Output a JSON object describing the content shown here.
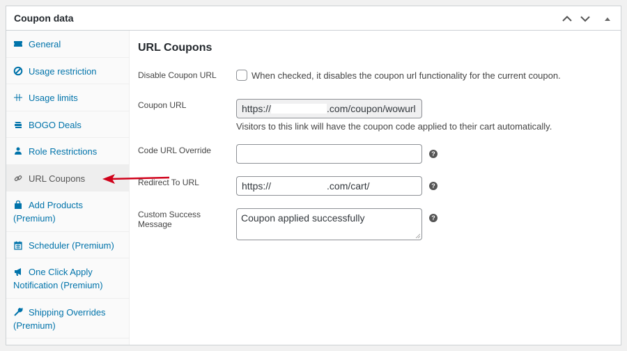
{
  "panel": {
    "title": "Coupon data",
    "controls": [
      "move-up",
      "move-down",
      "toggle-panel"
    ]
  },
  "sidebar": {
    "items": [
      {
        "label": "General",
        "icon": "ticket-icon",
        "active": false
      },
      {
        "label": "Usage restriction",
        "icon": "block-icon",
        "active": false
      },
      {
        "label": "Usage limits",
        "icon": "limits-icon",
        "active": false
      },
      {
        "label": "BOGO Deals",
        "icon": "bogo-icon",
        "active": false
      },
      {
        "label": "Role Restrictions",
        "icon": "user-icon",
        "active": false
      },
      {
        "label": "URL Coupons",
        "icon": "link-icon",
        "active": true
      },
      {
        "label": "Add Products (Premium)",
        "icon": "cart-bag-icon",
        "active": false
      },
      {
        "label": "Scheduler (Premium)",
        "icon": "calendar-icon",
        "active": false
      },
      {
        "label": "One Click Apply Notification (Premium)",
        "icon": "megaphone-icon",
        "active": false
      },
      {
        "label": "Shipping Overrides (Premium)",
        "icon": "wrench-icon",
        "active": false
      }
    ]
  },
  "main": {
    "heading": "URL Coupons",
    "fields": {
      "disable_url": {
        "label": "Disable Coupon URL",
        "checked": false,
        "description": "When checked, it disables the coupon url functionality for the current coupon."
      },
      "coupon_url": {
        "label": "Coupon URL",
        "value_prefix": "https://",
        "value_suffix": ".com/coupon/wowurl",
        "description": "Visitors to this link will have the coupon code applied to their cart automatically."
      },
      "code_url_override": {
        "label": "Code URL Override",
        "value": ""
      },
      "redirect_url": {
        "label": "Redirect To URL",
        "value_prefix": "https://",
        "value_suffix": ".com/cart/"
      },
      "success_message": {
        "label": "Custom Success Message",
        "value": "Coupon applied successfully"
      }
    },
    "help_glyph": "?"
  },
  "annotation": {
    "arrow_color": "#d0021b",
    "points_to": "URL Coupons"
  },
  "colors": {
    "link": "#0073aa",
    "active_tab_bg": "#eeeeee"
  }
}
